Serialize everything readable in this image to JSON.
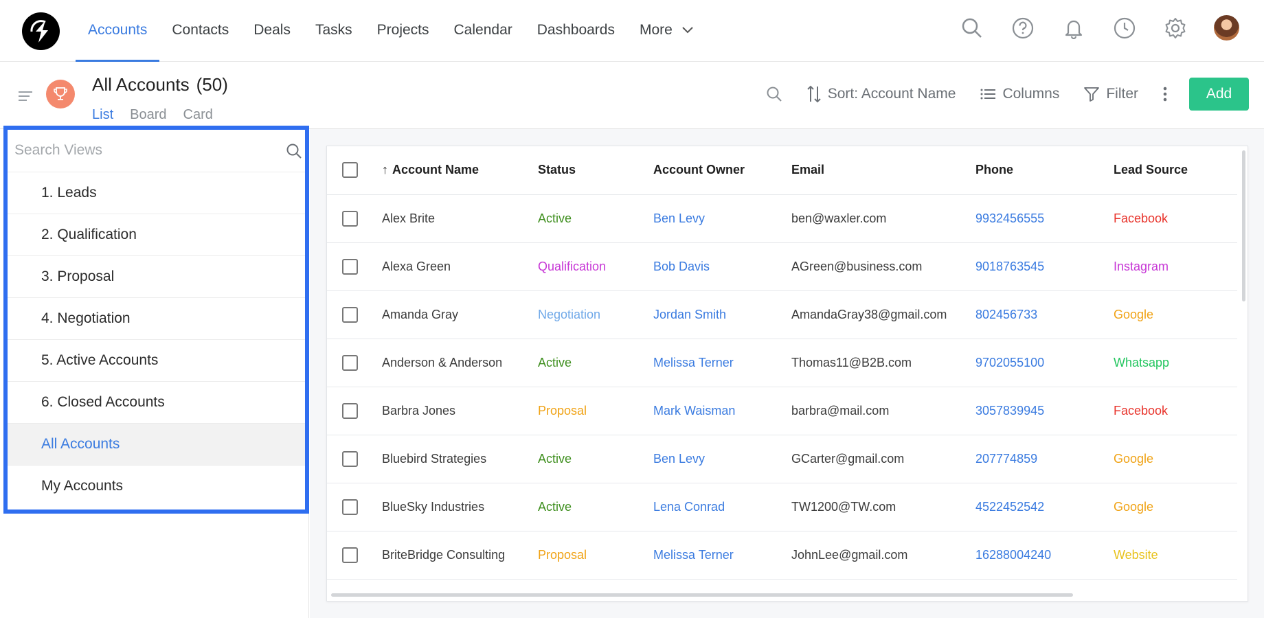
{
  "nav": {
    "items": [
      {
        "label": "Accounts",
        "active": true
      },
      {
        "label": "Contacts",
        "active": false
      },
      {
        "label": "Deals",
        "active": false
      },
      {
        "label": "Tasks",
        "active": false
      },
      {
        "label": "Projects",
        "active": false
      },
      {
        "label": "Calendar",
        "active": false
      },
      {
        "label": "Dashboards",
        "active": false
      }
    ],
    "more_label": "More",
    "icons": [
      "search-icon",
      "help-icon",
      "bell-icon",
      "clock-icon",
      "gear-icon",
      "avatar"
    ]
  },
  "header": {
    "title": "All Accounts",
    "count": "(50)",
    "view_tabs": [
      {
        "label": "List",
        "active": true
      },
      {
        "label": "Board",
        "active": false
      },
      {
        "label": "Card",
        "active": false
      }
    ]
  },
  "toolbar": {
    "sort_label": "Sort: Account Name",
    "columns_label": "Columns",
    "filter_label": "Filter",
    "add_label": "Add"
  },
  "views": {
    "search_placeholder": "Search Views",
    "items": [
      {
        "label": "1. Leads",
        "active": false
      },
      {
        "label": "2. Qualification",
        "active": false
      },
      {
        "label": "3. Proposal",
        "active": false
      },
      {
        "label": "4. Negotiation",
        "active": false
      },
      {
        "label": "5. Active Accounts",
        "active": false
      },
      {
        "label": "6. Closed Accounts",
        "active": false
      },
      {
        "label": "All Accounts",
        "active": true
      },
      {
        "label": "My Accounts",
        "active": false
      }
    ]
  },
  "table": {
    "columns": [
      "Account Name",
      "Status",
      "Account Owner",
      "Email",
      "Phone",
      "Lead Source"
    ],
    "sort_column": "Account Name",
    "rows": [
      {
        "name": "Alex Brite",
        "status": "Active",
        "owner": "Ben Levy",
        "email": "ben@waxler.com",
        "phone": "9932456555",
        "lead": "Facebook"
      },
      {
        "name": "Alexa Green",
        "status": "Qualification",
        "owner": "Bob Davis",
        "email": "AGreen@business.com",
        "phone": "9018763545",
        "lead": "Instagram"
      },
      {
        "name": "Amanda Gray",
        "status": "Negotiation",
        "owner": "Jordan Smith",
        "email": "AmandaGray38@gmail.com",
        "phone": "802456733",
        "lead": "Google"
      },
      {
        "name": "Anderson & Anderson",
        "status": "Active",
        "owner": "Melissa Terner",
        "email": "Thomas11@B2B.com",
        "phone": "9702055100",
        "lead": "Whatsapp"
      },
      {
        "name": "Barbra Jones",
        "status": "Proposal",
        "owner": "Mark Waisman",
        "email": "barbra@mail.com",
        "phone": "3057839945",
        "lead": "Facebook"
      },
      {
        "name": "Bluebird Strategies",
        "status": "Active",
        "owner": "Ben Levy",
        "email": "GCarter@gmail.com",
        "phone": "207774859",
        "lead": "Google"
      },
      {
        "name": "BlueSky Industries",
        "status": "Active",
        "owner": "Lena Conrad",
        "email": "TW1200@TW.com",
        "phone": "4522452542",
        "lead": "Google"
      },
      {
        "name": "BriteBridge Consulting",
        "status": "Proposal",
        "owner": "Melissa Terner",
        "email": "JohnLee@gmail.com",
        "phone": "16288004240",
        "lead": "Website"
      }
    ]
  },
  "colors": {
    "accent": "#3a7be0",
    "add_button": "#2bc48a",
    "highlight_border": "#2f6ef0",
    "status": {
      "Active": "#3f8f1f",
      "Qualification": "#c737d6",
      "Negotiation": "#6fa8e8",
      "Proposal": "#f0a214"
    },
    "lead": {
      "Facebook": "#e8332b",
      "Instagram": "#c737d6",
      "Google": "#f0a214",
      "Whatsapp": "#22c55e",
      "Website": "#e8c21c"
    }
  }
}
